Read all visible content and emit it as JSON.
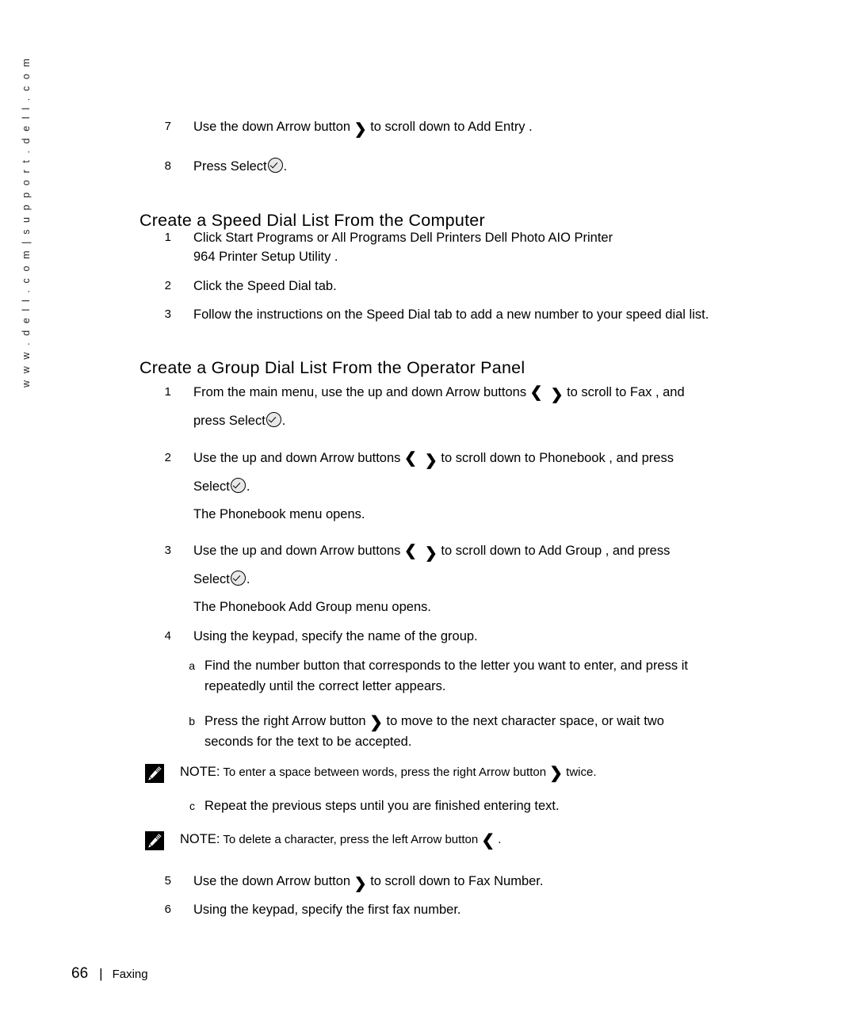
{
  "sidebar": {
    "url_text": "w w w . d e l l . c o m   |   s u p p o r t . d e l l . c o m"
  },
  "footer": {
    "page_number": "66",
    "separator": "|",
    "section": "Faxing"
  },
  "icons": {
    "arrow_down": "⌄",
    "arrow_up": "⌃",
    "arrow_right": "❯",
    "arrow_left": "❮",
    "select": "select-button-icon",
    "note": "note-pencil-icon"
  },
  "content": {
    "continued_steps": [
      {
        "num": "7",
        "pre": "Use the down Arrow button ",
        "icon": "arrow-down",
        "post": " to scroll down to Add Entry ."
      },
      {
        "num": "8",
        "pre": "Press Select",
        "icon": "select",
        "post": "."
      }
    ],
    "section_speed_dial": {
      "heading": "Create a Speed Dial List From the Computer",
      "steps": [
        {
          "num": "1",
          "line1": "Click Start   Programs or All Programs   Dell Printers   Dell Photo AIO Printer",
          "line2": "964   Printer Setup Utility ."
        },
        {
          "num": "2",
          "line1": "Click the Speed Dial tab."
        },
        {
          "num": "3",
          "line1": "Follow the instructions on the Speed Dial tab to add a new number to your speed dial list."
        }
      ]
    },
    "section_group_dial": {
      "heading": "Create a Group Dial List From the Operator Panel",
      "steps": [
        {
          "num": "1",
          "pre": "From the main menu, use the up and down Arrow buttons ",
          "mid": " to scroll to Fax , and",
          "line2_pre": "press Select",
          "line2_post": "."
        },
        {
          "num": "2",
          "pre": "Use the up and down Arrow buttons ",
          "mid": " to scroll down to Phonebook , and press",
          "line2_pre": "Select",
          "line2_post": ".",
          "result": "The Phonebook menu opens."
        },
        {
          "num": "3",
          "pre": "Use the up and down Arrow buttons ",
          "mid": " to scroll down to Add Group , and press",
          "line2_pre": "Select",
          "line2_post": ".",
          "result": "The Phonebook Add Group menu opens."
        },
        {
          "num": "4",
          "line1": "Using the keypad, specify the name of the group."
        }
      ],
      "substeps": [
        {
          "letter": "a",
          "line1": "Find the number button that corresponds to the letter you want to enter, and press it",
          "line2": "repeatedly until the correct letter appears."
        },
        {
          "letter": "b",
          "pre": "Press the right Arrow button ",
          "post": " to move to the next character space, or wait two",
          "line2": "seconds for the text to be accepted."
        },
        {
          "letter": "c",
          "line1": "Repeat the previous steps until you are finished entering text."
        }
      ],
      "notes": [
        {
          "label": "NOTE:",
          "pre": " To enter a space between words, press the right Arrow button ",
          "post": " twice."
        },
        {
          "label": "NOTE:",
          "pre": " To delete a character, press the left Arrow button ",
          "post": " ."
        }
      ],
      "final_steps": [
        {
          "num": "5",
          "pre": "Use the down Arrow button ",
          "post": " to scroll down to Fax Number."
        },
        {
          "num": "6",
          "line1": "Using the keypad, specify the first fax number."
        }
      ]
    }
  }
}
